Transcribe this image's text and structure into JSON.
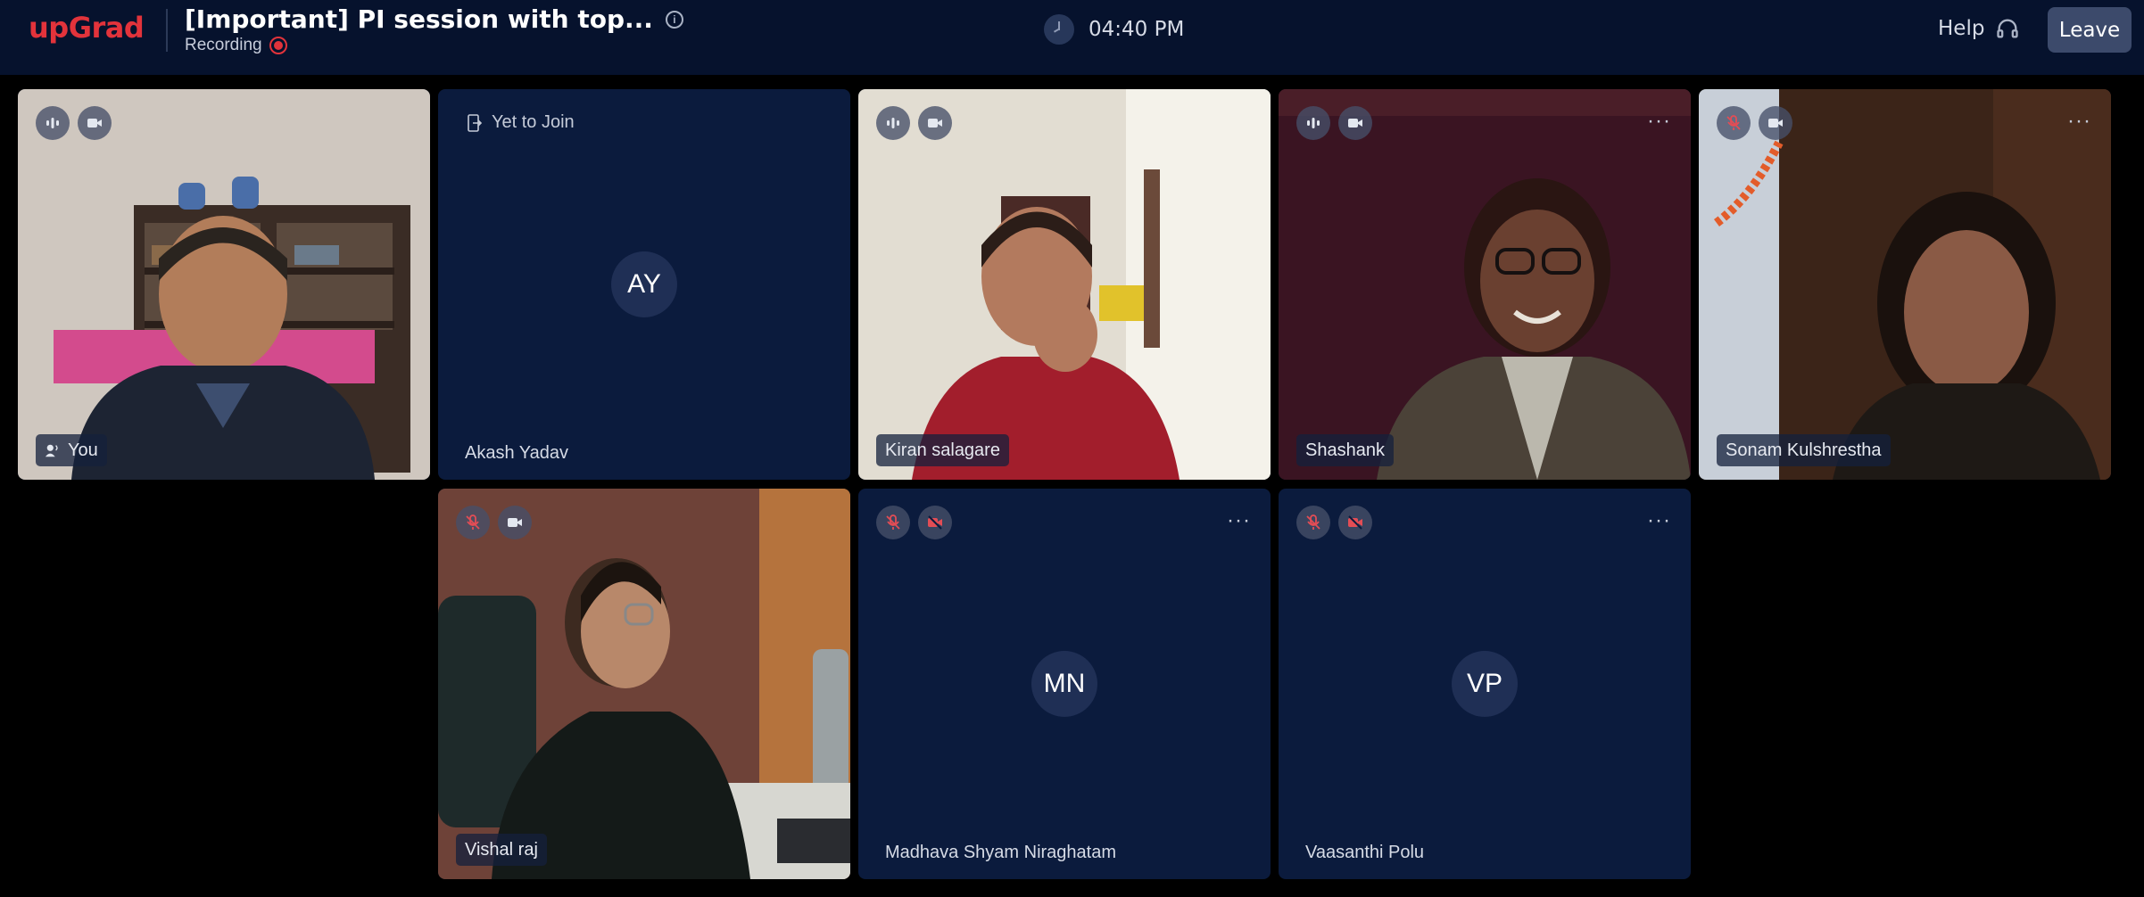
{
  "header": {
    "logo": "upGrad",
    "meeting_title": "[Important] PI session with top...",
    "recording_label": "Recording",
    "time": "04:40 PM",
    "help_label": "Help",
    "leave_label": "Leave"
  },
  "participants": [
    {
      "name": "You",
      "mic": "on",
      "camera": "on",
      "video": true
    },
    {
      "name": "Akash Yadav",
      "status": "Yet to Join",
      "initials": "AY",
      "video": false
    },
    {
      "name": "Kiran salagare",
      "mic": "on",
      "camera": "on",
      "video": true
    },
    {
      "name": "Shashank",
      "mic": "on",
      "camera": "on",
      "video": true
    },
    {
      "name": "Sonam Kulshrestha",
      "mic": "off",
      "camera": "on",
      "video": true
    },
    {
      "name": "Vishal raj",
      "mic": "off",
      "camera": "on",
      "video": true
    },
    {
      "name": "Madhava Shyam Niraghatam",
      "initials": "MN",
      "mic": "off",
      "camera": "off",
      "video": false
    },
    {
      "name": "Vaasanthi Polu",
      "initials": "VP",
      "mic": "off",
      "camera": "off",
      "video": false
    }
  ],
  "colors": {
    "brand_red": "#e2333b",
    "header_bg": "#06122d",
    "tile_bg": "#0b1b3d",
    "leave_button": "#3c4a6b"
  }
}
